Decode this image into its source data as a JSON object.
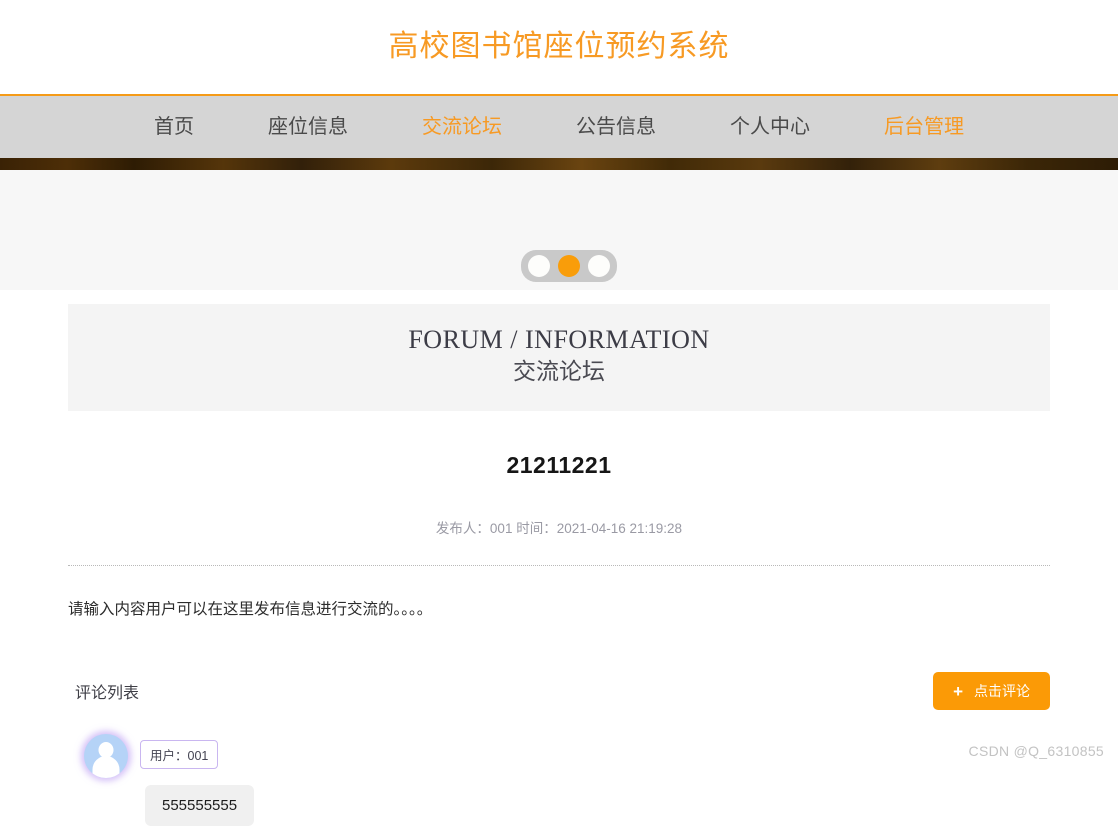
{
  "site": {
    "title": "高校图书馆座位预约系统",
    "accent_color": "#f79a24",
    "nav_bg_color": "#d5d5d5"
  },
  "nav": {
    "items": [
      {
        "label": "首页",
        "active": false
      },
      {
        "label": "座位信息",
        "active": false
      },
      {
        "label": "交流论坛",
        "active": true
      },
      {
        "label": "公告信息",
        "active": false
      },
      {
        "label": "个人中心",
        "active": false
      },
      {
        "label": "后台管理",
        "active": true
      }
    ]
  },
  "carousel": {
    "slide_count": 3,
    "active_index": 1,
    "active_dot_color": "#f99d0a",
    "inactive_dot_color": "#fdfdfb",
    "track_color": "#c9c9c9"
  },
  "forum": {
    "header_en": "FORUM / INFORMATION",
    "header_cn": "交流论坛",
    "post": {
      "title": "21211221",
      "meta": "发布人：001 时间：2021-04-16 21:19:28",
      "body": "请输入内容用户可以在这里发布信息进行交流的。。。。"
    },
    "comments_section": {
      "list_title": "评论列表",
      "add_button_label": "点击评论",
      "add_button_icon": "plus-icon",
      "add_button_color": "#fb9a06",
      "items": [
        {
          "avatar_icon": "user-avatar-icon",
          "user_chip": "用户：001",
          "text": "555555555"
        }
      ]
    }
  },
  "watermark": {
    "text": "CSDN @Q_6310855"
  }
}
